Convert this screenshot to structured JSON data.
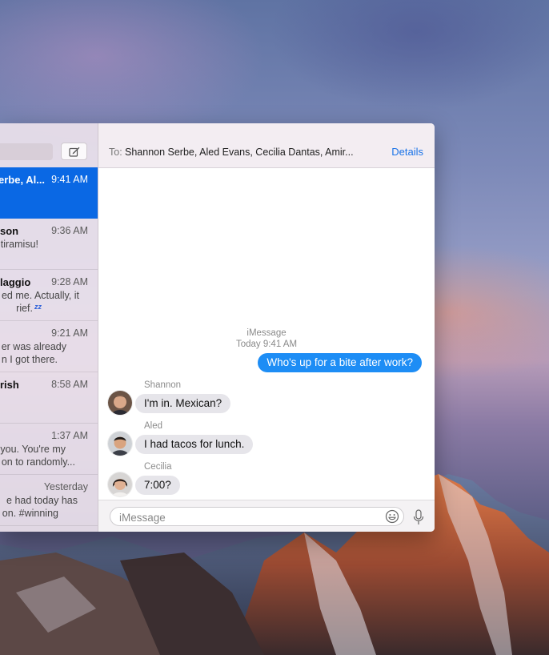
{
  "sidebar": {
    "conversations": [
      {
        "name": "erbe, Al...",
        "time": "9:41 AM",
        "preview1": "",
        "preview2": "",
        "selected": true
      },
      {
        "name": "son",
        "time": "9:36 AM",
        "preview1": "tiramisu!",
        "preview2": ""
      },
      {
        "name": "laggio",
        "time": "9:28 AM",
        "preview1": "ed me. Actually, it",
        "preview2": "rief."
      },
      {
        "name": "",
        "time": "9:21 AM",
        "preview1": "er was already",
        "preview2": "n I got there."
      },
      {
        "name": "rish",
        "time": "8:58 AM",
        "preview1": "",
        "preview2": ""
      },
      {
        "name": "",
        "time": "1:37 AM",
        "preview1": "you. You're my",
        "preview2": "on to randomly..."
      },
      {
        "name": "",
        "time": "Yesterday",
        "preview1": "e had today has",
        "preview2": "on. #winning"
      }
    ]
  },
  "header": {
    "to_label": "To:",
    "recipients": "Shannon Serbe, Aled Evans, Cecilia Dantas, Amir...",
    "details_label": "Details"
  },
  "thread": {
    "service_name": "iMessage",
    "timestamp": "Today 9:41 AM",
    "outgoing_message": "Who's up for a bite after work?",
    "messages": [
      {
        "sender": "Shannon",
        "text": "I'm in. Mexican?"
      },
      {
        "sender": "Aled",
        "text": "I had tacos for lunch."
      },
      {
        "sender": "Cecilia",
        "text": "7:00?"
      }
    ]
  },
  "composer": {
    "placeholder": "iMessage"
  },
  "colors": {
    "accent": "#0a68e4",
    "outgoing_bubble": "#1d8df5",
    "incoming_bubble": "#e6e5ea",
    "link": "#1a73e8"
  },
  "icons": {
    "compose": "compose-icon",
    "emoji": "emoji-icon",
    "microphone": "microphone-icon",
    "sleep": "zz-icon"
  }
}
